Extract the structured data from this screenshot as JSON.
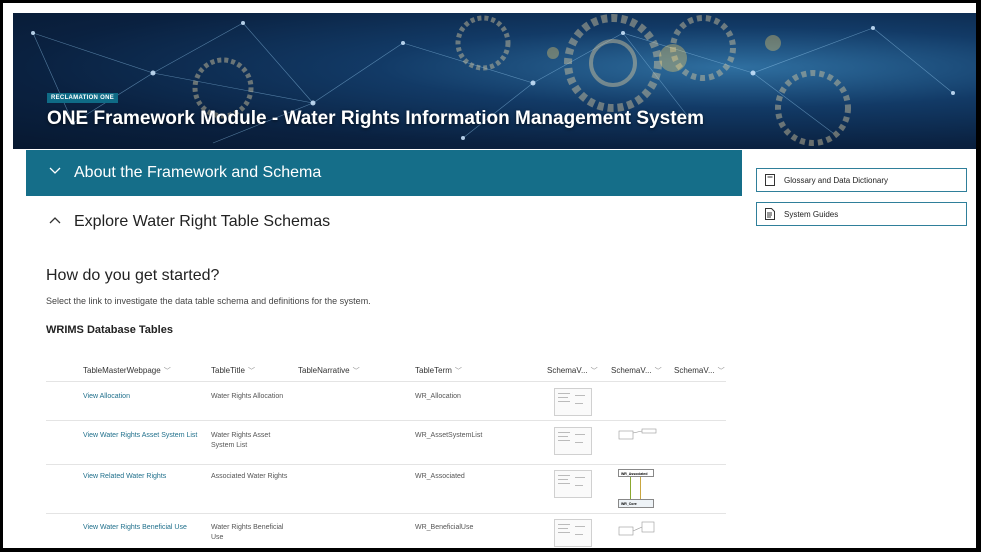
{
  "hero": {
    "badge": "RECLAMATION ONE",
    "title": "ONE Framework Module - Water Rights Information Management System"
  },
  "accordion": [
    {
      "label": "About the Framework and Schema",
      "state": "collapsed",
      "icon": "chevron-down-icon"
    },
    {
      "label": "Explore Water Right Table Schemas",
      "state": "expanded",
      "icon": "chevron-up-icon"
    }
  ],
  "side_links": [
    {
      "label": "Glossary and Data Dictionary",
      "icon": "document-icon"
    },
    {
      "label": "System Guides",
      "icon": "guide-icon"
    }
  ],
  "content": {
    "heading": "How do you get started?",
    "description": "Select the link to investigate the data table schema and definitions for the system.",
    "table_heading": "WRIMS Database Tables"
  },
  "table": {
    "columns": [
      "TableMasterWebpage",
      "TableTitle",
      "TableNarrative",
      "TableTerm",
      "SchemaV...",
      "SchemaV...",
      "SchemaV..."
    ],
    "rows": [
      {
        "webpage": "View Allocation",
        "title": "Water Rights Allocation",
        "narrative": "",
        "term": "WR_Allocation"
      },
      {
        "webpage": "View Water Rights Asset System List",
        "title": "Water Rights Asset System List",
        "narrative": "",
        "term": "WR_AssetSystemList"
      },
      {
        "webpage": "View Related Water Rights",
        "title": "Associated Water Rights",
        "narrative": "",
        "term": "WR_Associated",
        "diagram_labels": [
          "WR_Associated",
          "WR_Core"
        ]
      },
      {
        "webpage": "View Water Rights Beneficial Use",
        "title": "Water Rights Beneficial Use",
        "narrative": "",
        "term": "WR_BeneficialUse"
      }
    ]
  },
  "colors": {
    "accent": "#156e89",
    "link": "#1f6f8b",
    "border": "#2f7f9a"
  }
}
